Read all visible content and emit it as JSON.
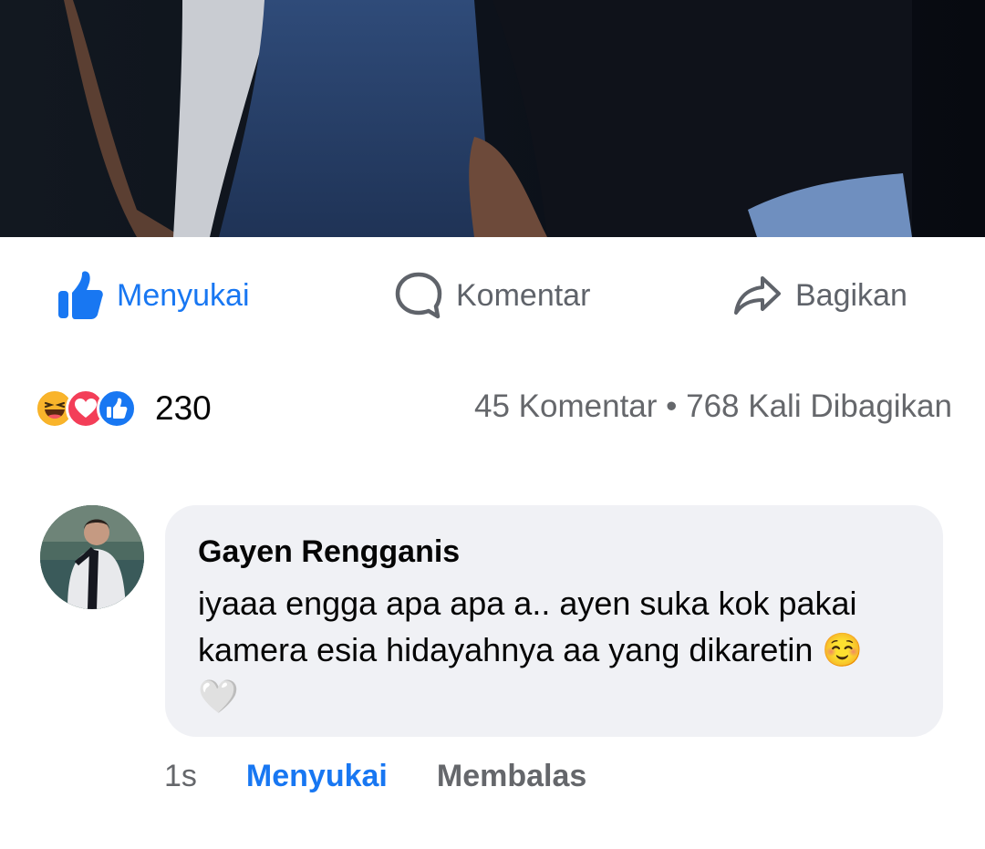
{
  "post": {
    "photo_alt": "post-photo",
    "actions": {
      "like_label": "Menyukai",
      "comment_label": "Komentar",
      "share_label": "Bagikan"
    },
    "stats": {
      "reaction_count": "230",
      "comments_shares": "45 Komentar • 768 Kali Dibagikan",
      "reaction_icons": [
        "haha-icon",
        "love-icon",
        "like-icon"
      ]
    }
  },
  "comment": {
    "author": "Gayen Rengganis",
    "text": "iyaaa engga apa apa a.. ayen suka kok pakai kamera esia hidayahnya aa yang dikaretin ☺️🤍",
    "time": "1s",
    "like_label": "Menyukai",
    "reply_label": "Membalas"
  },
  "colors": {
    "accent": "#1877f2",
    "muted": "#65676b",
    "bubble": "#f0f1f5"
  }
}
